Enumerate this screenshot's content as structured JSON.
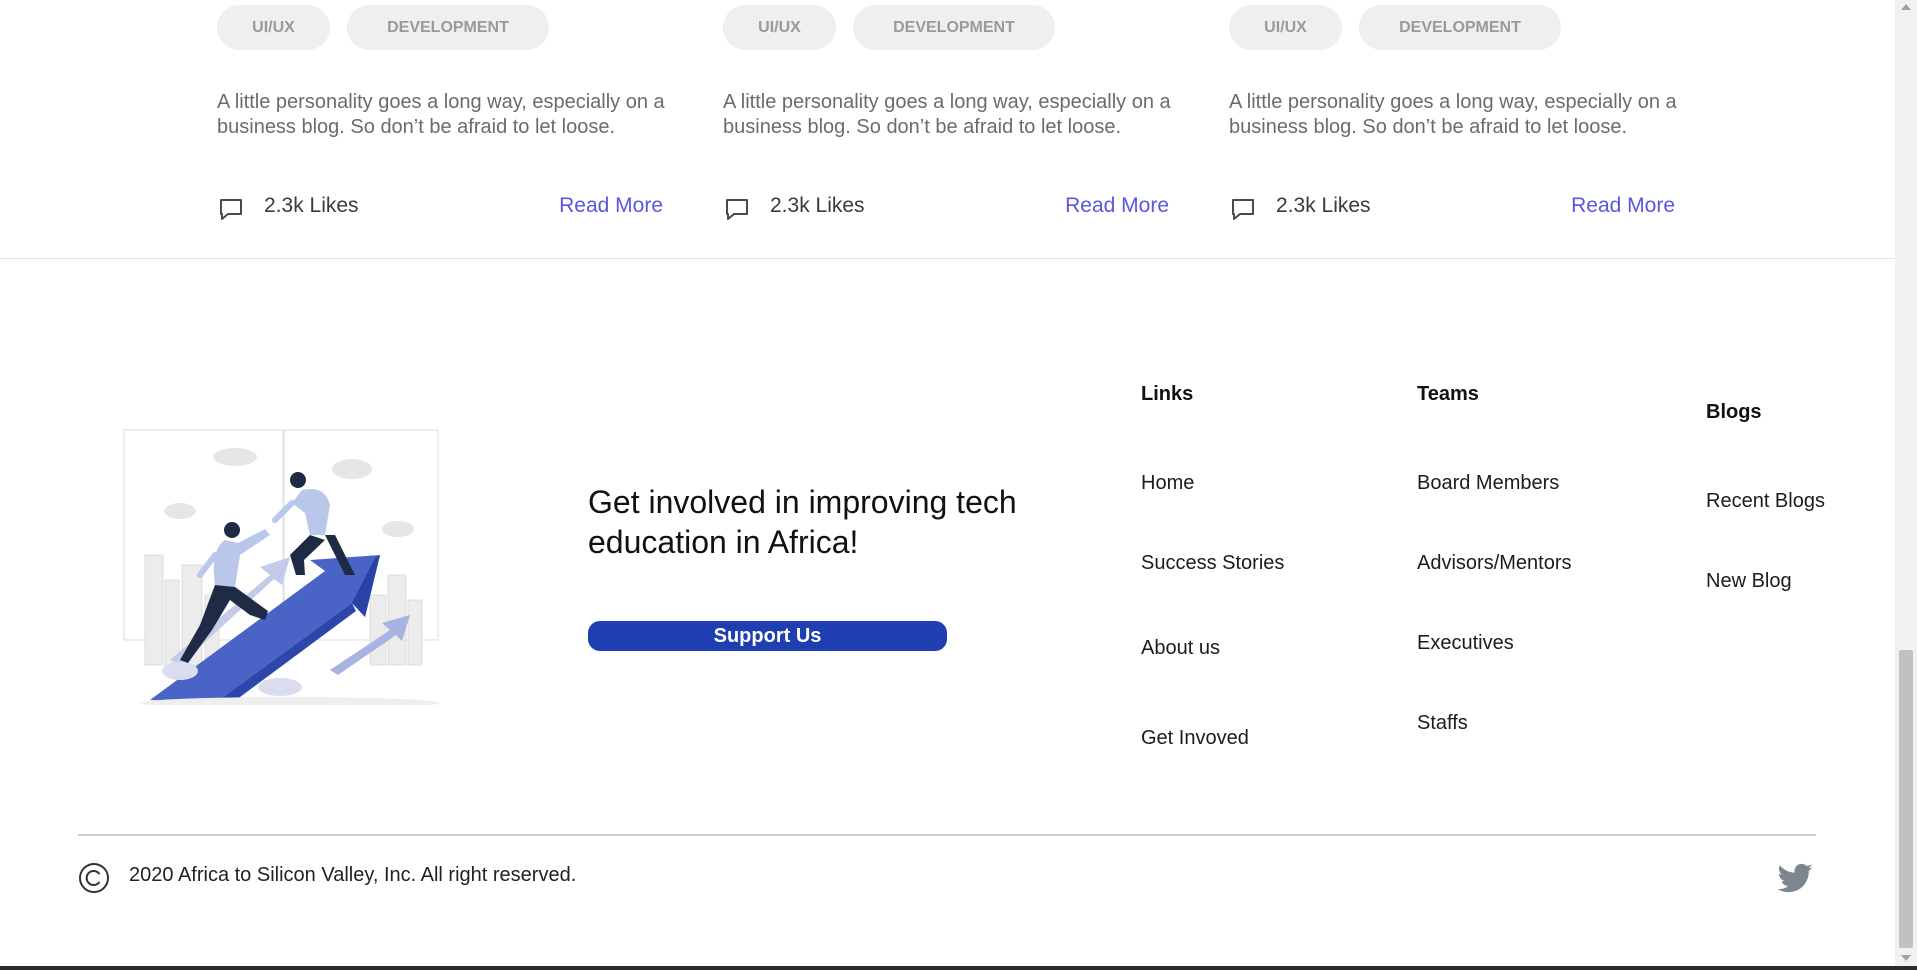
{
  "cards": [
    {
      "tags": [
        "UI/UX",
        "DEVELOPMENT"
      ],
      "description": "A little personality goes a long way, especially on a business blog. So don’t be afraid to let loose.",
      "likes": "2.3k Likes",
      "read_more": "Read More"
    },
    {
      "tags": [
        "UI/UX",
        "DEVELOPMENT"
      ],
      "description": "A little personality goes a long way, especially on a business blog. So don’t be afraid to let loose.",
      "likes": "2.3k Likes",
      "read_more": "Read More"
    },
    {
      "tags": [
        "UI/UX",
        "DEVELOPMENT"
      ],
      "description": "A little personality goes a long way, especially on a business blog. So don’t be afraid to let loose.",
      "likes": "2.3k Likes",
      "read_more": "Read More"
    }
  ],
  "footer": {
    "cta_title": "Get involved in improving tech education in Africa!",
    "support_button": "Support Us",
    "links": {
      "title": "Links",
      "items": [
        "Home",
        "Success Stories",
        "About us",
        "Get Invoved"
      ]
    },
    "teams": {
      "title": "Teams",
      "items": [
        "Board Members",
        "Advisors/Mentors",
        "Executives",
        "Staffs"
      ]
    },
    "blogs": {
      "title": "Blogs",
      "items": [
        "Recent Blogs",
        "New Blog"
      ]
    },
    "copyright": "2020 Africa to Silicon Valley, Inc. All right reserved."
  },
  "colors": {
    "accent": "#5b56e0",
    "button": "#1e3eb1",
    "tag_bg": "#efefef",
    "illustration_blue": "#4a63c7"
  },
  "icons": [
    "comment-icon",
    "copyright-icon",
    "twitter-icon"
  ]
}
